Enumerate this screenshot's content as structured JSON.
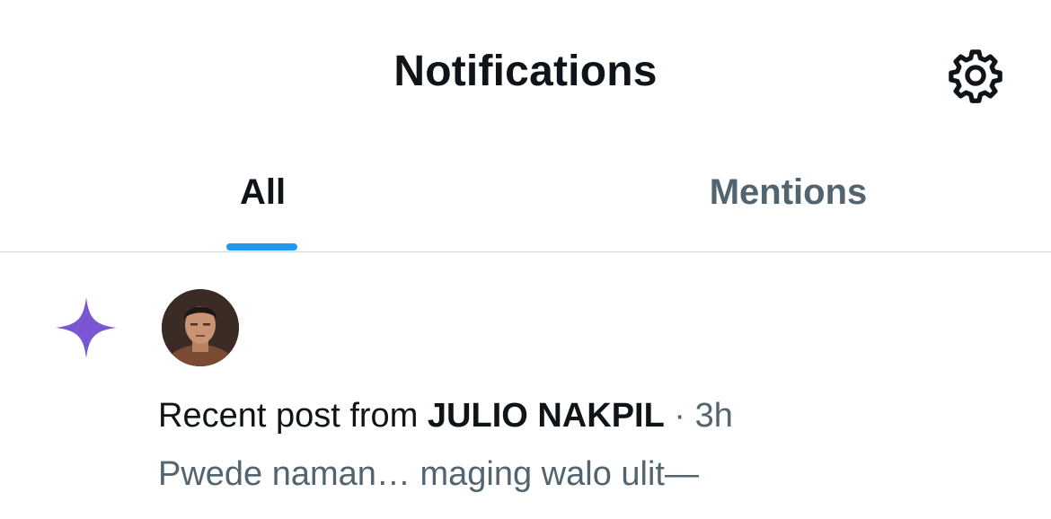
{
  "header": {
    "title": "Notifications",
    "settings_icon": "gear-icon"
  },
  "tabs": [
    {
      "label": "All",
      "selected": true
    },
    {
      "label": "Mentions",
      "selected": false
    }
  ],
  "colors": {
    "accent": "#1d9bf0",
    "sparkle": "#7856d4",
    "secondary_text": "#536471",
    "primary_text": "#0f1419",
    "divider": "#cfd9de"
  },
  "notification": {
    "icon": "sparkle-icon",
    "prefix": "Recent post from ",
    "author": "JULIO NAKPIL",
    "separator": " · ",
    "time": "3h",
    "snippet": "Pwede naman…  maging walo ulit—"
  }
}
